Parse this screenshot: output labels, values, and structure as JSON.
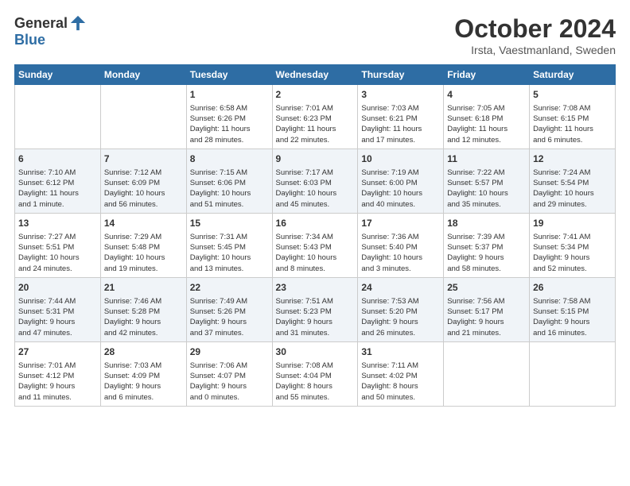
{
  "header": {
    "logo_general": "General",
    "logo_blue": "Blue",
    "title": "October 2024",
    "subtitle": "Irsta, Vaestmanland, Sweden"
  },
  "weekdays": [
    "Sunday",
    "Monday",
    "Tuesday",
    "Wednesday",
    "Thursday",
    "Friday",
    "Saturday"
  ],
  "weeks": [
    [
      {
        "day": "",
        "content": ""
      },
      {
        "day": "",
        "content": ""
      },
      {
        "day": "1",
        "content": "Sunrise: 6:58 AM\nSunset: 6:26 PM\nDaylight: 11 hours\nand 28 minutes."
      },
      {
        "day": "2",
        "content": "Sunrise: 7:01 AM\nSunset: 6:23 PM\nDaylight: 11 hours\nand 22 minutes."
      },
      {
        "day": "3",
        "content": "Sunrise: 7:03 AM\nSunset: 6:21 PM\nDaylight: 11 hours\nand 17 minutes."
      },
      {
        "day": "4",
        "content": "Sunrise: 7:05 AM\nSunset: 6:18 PM\nDaylight: 11 hours\nand 12 minutes."
      },
      {
        "day": "5",
        "content": "Sunrise: 7:08 AM\nSunset: 6:15 PM\nDaylight: 11 hours\nand 6 minutes."
      }
    ],
    [
      {
        "day": "6",
        "content": "Sunrise: 7:10 AM\nSunset: 6:12 PM\nDaylight: 11 hours\nand 1 minute."
      },
      {
        "day": "7",
        "content": "Sunrise: 7:12 AM\nSunset: 6:09 PM\nDaylight: 10 hours\nand 56 minutes."
      },
      {
        "day": "8",
        "content": "Sunrise: 7:15 AM\nSunset: 6:06 PM\nDaylight: 10 hours\nand 51 minutes."
      },
      {
        "day": "9",
        "content": "Sunrise: 7:17 AM\nSunset: 6:03 PM\nDaylight: 10 hours\nand 45 minutes."
      },
      {
        "day": "10",
        "content": "Sunrise: 7:19 AM\nSunset: 6:00 PM\nDaylight: 10 hours\nand 40 minutes."
      },
      {
        "day": "11",
        "content": "Sunrise: 7:22 AM\nSunset: 5:57 PM\nDaylight: 10 hours\nand 35 minutes."
      },
      {
        "day": "12",
        "content": "Sunrise: 7:24 AM\nSunset: 5:54 PM\nDaylight: 10 hours\nand 29 minutes."
      }
    ],
    [
      {
        "day": "13",
        "content": "Sunrise: 7:27 AM\nSunset: 5:51 PM\nDaylight: 10 hours\nand 24 minutes."
      },
      {
        "day": "14",
        "content": "Sunrise: 7:29 AM\nSunset: 5:48 PM\nDaylight: 10 hours\nand 19 minutes."
      },
      {
        "day": "15",
        "content": "Sunrise: 7:31 AM\nSunset: 5:45 PM\nDaylight: 10 hours\nand 13 minutes."
      },
      {
        "day": "16",
        "content": "Sunrise: 7:34 AM\nSunset: 5:43 PM\nDaylight: 10 hours\nand 8 minutes."
      },
      {
        "day": "17",
        "content": "Sunrise: 7:36 AM\nSunset: 5:40 PM\nDaylight: 10 hours\nand 3 minutes."
      },
      {
        "day": "18",
        "content": "Sunrise: 7:39 AM\nSunset: 5:37 PM\nDaylight: 9 hours\nand 58 minutes."
      },
      {
        "day": "19",
        "content": "Sunrise: 7:41 AM\nSunset: 5:34 PM\nDaylight: 9 hours\nand 52 minutes."
      }
    ],
    [
      {
        "day": "20",
        "content": "Sunrise: 7:44 AM\nSunset: 5:31 PM\nDaylight: 9 hours\nand 47 minutes."
      },
      {
        "day": "21",
        "content": "Sunrise: 7:46 AM\nSunset: 5:28 PM\nDaylight: 9 hours\nand 42 minutes."
      },
      {
        "day": "22",
        "content": "Sunrise: 7:49 AM\nSunset: 5:26 PM\nDaylight: 9 hours\nand 37 minutes."
      },
      {
        "day": "23",
        "content": "Sunrise: 7:51 AM\nSunset: 5:23 PM\nDaylight: 9 hours\nand 31 minutes."
      },
      {
        "day": "24",
        "content": "Sunrise: 7:53 AM\nSunset: 5:20 PM\nDaylight: 9 hours\nand 26 minutes."
      },
      {
        "day": "25",
        "content": "Sunrise: 7:56 AM\nSunset: 5:17 PM\nDaylight: 9 hours\nand 21 minutes."
      },
      {
        "day": "26",
        "content": "Sunrise: 7:58 AM\nSunset: 5:15 PM\nDaylight: 9 hours\nand 16 minutes."
      }
    ],
    [
      {
        "day": "27",
        "content": "Sunrise: 7:01 AM\nSunset: 4:12 PM\nDaylight: 9 hours\nand 11 minutes."
      },
      {
        "day": "28",
        "content": "Sunrise: 7:03 AM\nSunset: 4:09 PM\nDaylight: 9 hours\nand 6 minutes."
      },
      {
        "day": "29",
        "content": "Sunrise: 7:06 AM\nSunset: 4:07 PM\nDaylight: 9 hours\nand 0 minutes."
      },
      {
        "day": "30",
        "content": "Sunrise: 7:08 AM\nSunset: 4:04 PM\nDaylight: 8 hours\nand 55 minutes."
      },
      {
        "day": "31",
        "content": "Sunrise: 7:11 AM\nSunset: 4:02 PM\nDaylight: 8 hours\nand 50 minutes."
      },
      {
        "day": "",
        "content": ""
      },
      {
        "day": "",
        "content": ""
      }
    ]
  ]
}
